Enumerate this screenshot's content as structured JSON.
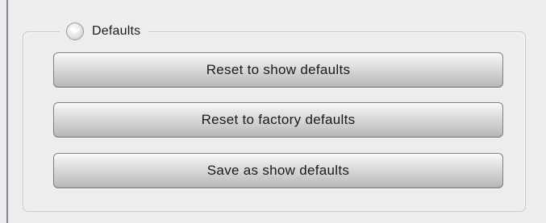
{
  "group": {
    "title": "Defaults",
    "toggle_icon": "circle-toggle-icon"
  },
  "buttons": [
    {
      "label": "Reset to show defaults"
    },
    {
      "label": "Reset to factory defaults"
    },
    {
      "label": "Save as show defaults"
    }
  ]
}
